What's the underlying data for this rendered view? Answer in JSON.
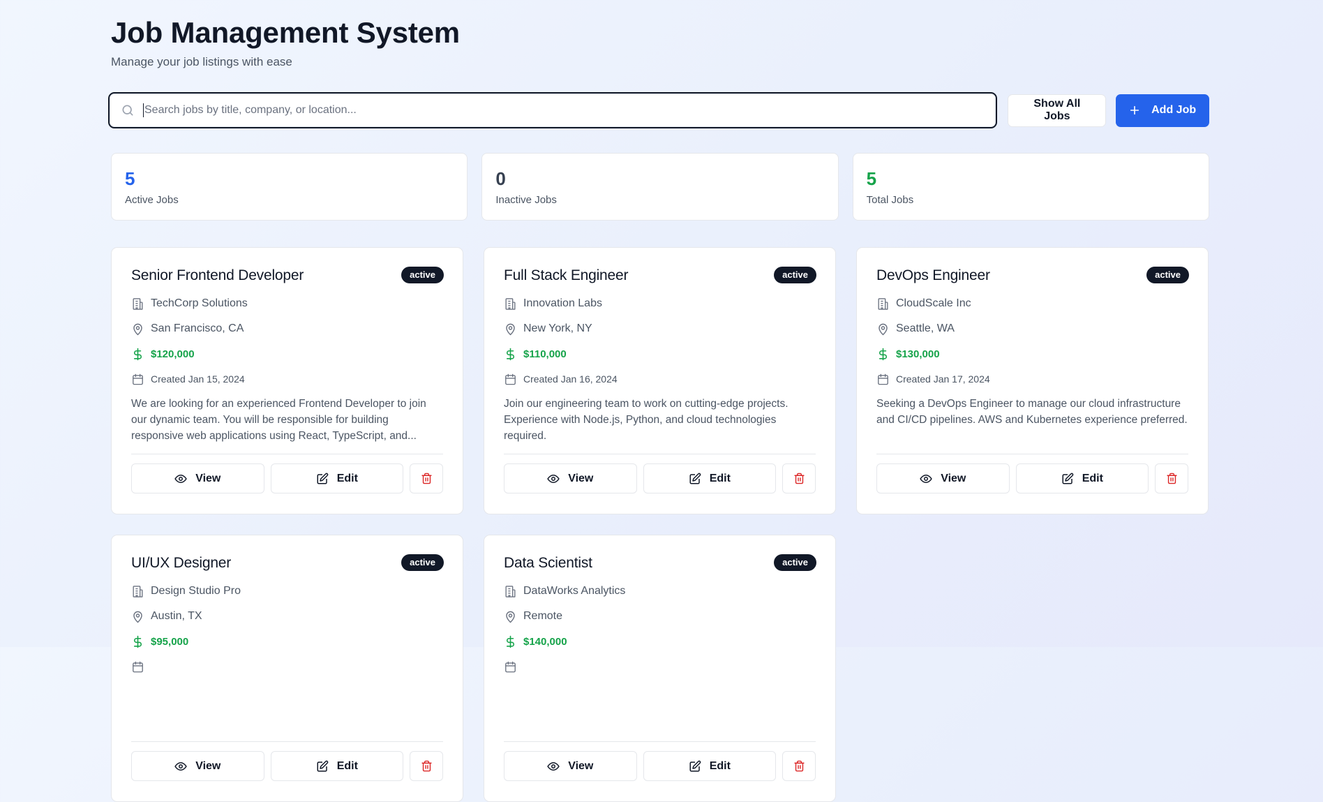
{
  "header": {
    "title": "Job Management System",
    "subtitle": "Manage your job listings with ease"
  },
  "toolbar": {
    "search_placeholder": "Search jobs by title, company, or location...",
    "search_value": "",
    "show_all_label": "Show All Jobs",
    "add_job_label": "Add Job"
  },
  "stats": [
    {
      "value": "5",
      "label": "Active Jobs",
      "color": "#2563eb"
    },
    {
      "value": "0",
      "label": "Inactive Jobs",
      "color": "#374151"
    },
    {
      "value": "5",
      "label": "Total Jobs",
      "color": "#16a34a"
    }
  ],
  "actions": {
    "view": "View",
    "edit": "Edit"
  },
  "jobs": [
    {
      "title": "Senior Frontend Developer",
      "status": "active",
      "company": "TechCorp Solutions",
      "location": "San Francisco, CA",
      "salary": "$120,000",
      "created": "Created Jan 15, 2024",
      "description": "We are looking for an experienced Frontend Developer to join our dynamic team. You will be responsible for building responsive web applications using React, TypeScript, and..."
    },
    {
      "title": "Full Stack Engineer",
      "status": "active",
      "company": "Innovation Labs",
      "location": "New York, NY",
      "salary": "$110,000",
      "created": "Created Jan 16, 2024",
      "description": "Join our engineering team to work on cutting-edge projects. Experience with Node.js, Python, and cloud technologies required."
    },
    {
      "title": "DevOps Engineer",
      "status": "active",
      "company": "CloudScale Inc",
      "location": "Seattle, WA",
      "salary": "$130,000",
      "created": "Created Jan 17, 2024",
      "description": "Seeking a DevOps Engineer to manage our cloud infrastructure and CI/CD pipelines. AWS and Kubernetes experience preferred."
    },
    {
      "title": "UI/UX Designer",
      "status": "active",
      "company": "Design Studio Pro",
      "location": "Austin, TX",
      "salary": "$95,000",
      "created": "",
      "description": ""
    },
    {
      "title": "Data Scientist",
      "status": "active",
      "company": "DataWorks Analytics",
      "location": "Remote",
      "salary": "$140,000",
      "created": "",
      "description": ""
    }
  ],
  "colors": {
    "accent": "#2563eb",
    "salary": "#16a34a",
    "badge": "#111827",
    "delete": "#dc2626"
  }
}
